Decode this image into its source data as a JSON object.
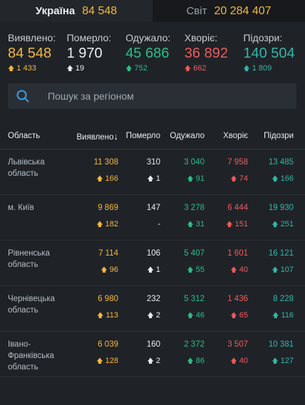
{
  "tabs": [
    {
      "name": "Україна",
      "value": "84 548"
    },
    {
      "name": "Світ",
      "value": "20 284 407"
    }
  ],
  "summary": [
    {
      "label": "Виявлено:",
      "value": "84 548",
      "delta": "1 433"
    },
    {
      "label": "Померло:",
      "value": "1 970",
      "delta": "19"
    },
    {
      "label": "Одужало:",
      "value": "45 686",
      "delta": "752"
    },
    {
      "label": "Хворіє:",
      "value": "36 892",
      "delta": "662"
    },
    {
      "label": "Підозри:",
      "value": "140 504",
      "delta": "1 809"
    }
  ],
  "search": {
    "placeholder": "Пошук за регіоном"
  },
  "table": {
    "headers": [
      "Область",
      "Виявлено",
      "Померло",
      "Одужало",
      "Хворіє",
      "Підозри"
    ],
    "sort_arrow": "↓",
    "rows": [
      {
        "region": "Львівська область",
        "cells": [
          [
            "11 308",
            "166"
          ],
          [
            "310",
            "1"
          ],
          [
            "3 040",
            "91"
          ],
          [
            "7 958",
            "74"
          ],
          [
            "13 485",
            "166"
          ]
        ]
      },
      {
        "region": "м. Київ",
        "cells": [
          [
            "9 869",
            "182"
          ],
          [
            "147",
            "-"
          ],
          [
            "3 278",
            "31"
          ],
          [
            "6 444",
            "151"
          ],
          [
            "19 930",
            "251"
          ]
        ]
      },
      {
        "region": "Рівненська область",
        "cells": [
          [
            "7 114",
            "96"
          ],
          [
            "106",
            "1"
          ],
          [
            "5 407",
            "55"
          ],
          [
            "1 601",
            "40"
          ],
          [
            "16 121",
            "107"
          ]
        ]
      },
      {
        "region": "Чернівецька область",
        "cells": [
          [
            "6 980",
            "113"
          ],
          [
            "232",
            "2"
          ],
          [
            "5 312",
            "46"
          ],
          [
            "1 436",
            "65"
          ],
          [
            "8 228",
            "116"
          ]
        ]
      },
      {
        "region": "Івано-Франківська область",
        "cells": [
          [
            "6 039",
            "128"
          ],
          [
            "160",
            "2"
          ],
          [
            "2 372",
            "86"
          ],
          [
            "3 507",
            "40"
          ],
          [
            "10 381",
            "127"
          ]
        ]
      }
    ]
  },
  "colors": {
    "confirmed": "#f6b73c",
    "deaths": "#e9ecef",
    "recovered": "#2dbd85",
    "sick": "#f05a5a",
    "suspected": "#35b5a7"
  }
}
